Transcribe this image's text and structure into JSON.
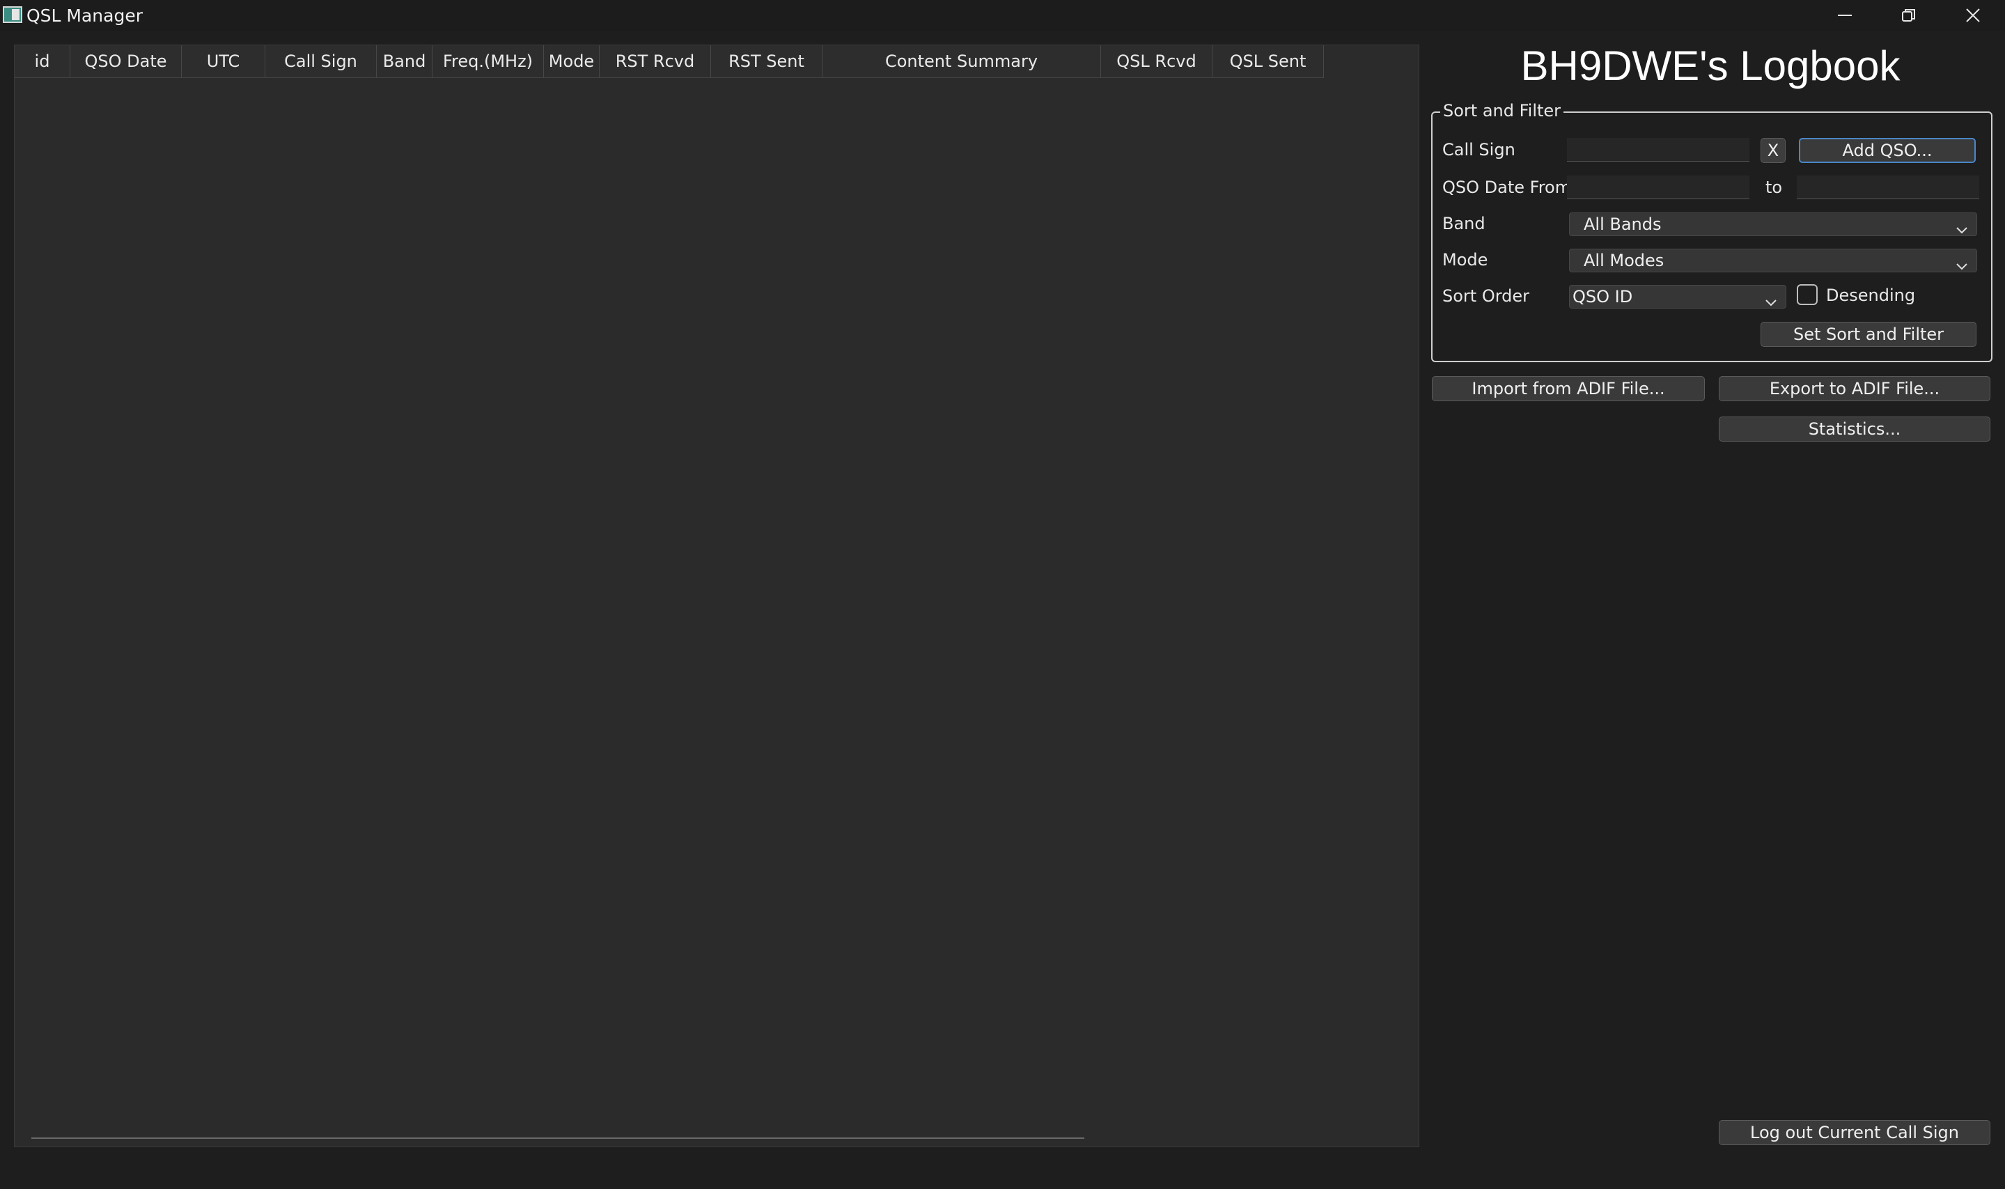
{
  "window": {
    "title": "QSL Manager",
    "controls": {
      "minimize_icon": "minimize-icon",
      "restore_icon": "restore-icon",
      "close_icon": "close-icon"
    }
  },
  "table": {
    "columns": [
      "id",
      "QSO Date",
      "UTC",
      "Call Sign",
      "Band",
      "Freq.(MHz)",
      "Mode",
      "RST Rcvd",
      "RST Sent",
      "Content Summary",
      "QSL Rcvd",
      "QSL Sent"
    ],
    "rows": []
  },
  "panel": {
    "logbook_title": "BH9DWE's Logbook",
    "sort_filter": {
      "group_title": "Sort and Filter",
      "call_sign_label": "Call Sign",
      "call_sign_value": "",
      "clear_label": "X",
      "add_qso_label": "Add QSO...",
      "date_from_label": "QSO Date From",
      "date_from_value": "",
      "to_label": "to",
      "date_to_value": "",
      "band_label": "Band",
      "band_value": "All Bands",
      "mode_label": "Mode",
      "mode_value": "All Modes",
      "sort_order_label": "Sort Order",
      "sort_order_value": "QSO ID",
      "descending_label": "Desending",
      "descending_checked": false,
      "apply_label": "Set Sort and Filter"
    },
    "import_label": "Import from ADIF File...",
    "export_label": "Export to ADIF File...",
    "statistics_label": "Statistics...",
    "logout_label": "Log out Current Call Sign"
  },
  "colors": {
    "background": "#1e1e1e",
    "table_background": "#2b2b2b",
    "accent_border": "#4a86c7"
  }
}
